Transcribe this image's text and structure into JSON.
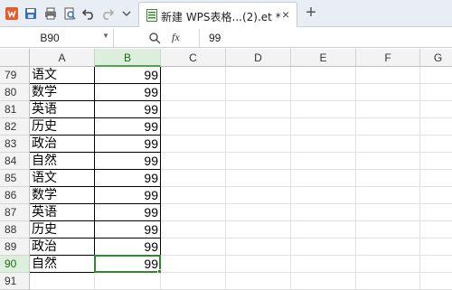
{
  "toolbar": {
    "quick_access_icons": [
      "wps-logo-icon",
      "save-icon",
      "print-icon",
      "print-preview-icon",
      "undo-icon",
      "redo-icon",
      "dropdown-icon"
    ]
  },
  "document_tab": {
    "title": "新建 WPS表格...(2).et *",
    "close_label": "×",
    "new_tab_label": "+"
  },
  "formula_bar": {
    "name_box": "B90",
    "fx_label": "fx",
    "value": "99"
  },
  "grid": {
    "columns": [
      "A",
      "B",
      "C",
      "D",
      "E",
      "F",
      "G"
    ],
    "selected_column": "B",
    "selected_row": "90",
    "rows": [
      {
        "row": "79",
        "a": "语文",
        "b": "99"
      },
      {
        "row": "80",
        "a": "数学",
        "b": "99"
      },
      {
        "row": "81",
        "a": "英语",
        "b": "99"
      },
      {
        "row": "82",
        "a": "历史",
        "b": "99"
      },
      {
        "row": "83",
        "a": "政治",
        "b": "99"
      },
      {
        "row": "84",
        "a": "自然",
        "b": "99"
      },
      {
        "row": "85",
        "a": "语文",
        "b": "99"
      },
      {
        "row": "86",
        "a": "数学",
        "b": "99"
      },
      {
        "row": "87",
        "a": "英语",
        "b": "99"
      },
      {
        "row": "88",
        "a": "历史",
        "b": "99"
      },
      {
        "row": "89",
        "a": "政治",
        "b": "99"
      },
      {
        "row": "90",
        "a": "自然",
        "b": "99"
      },
      {
        "row": "91",
        "a": "",
        "b": ""
      }
    ]
  },
  "colors": {
    "selection_green": "#2f8a2f",
    "header_selected_bg": "#dcefdc",
    "titlebar_bg": "#e9eef5"
  }
}
